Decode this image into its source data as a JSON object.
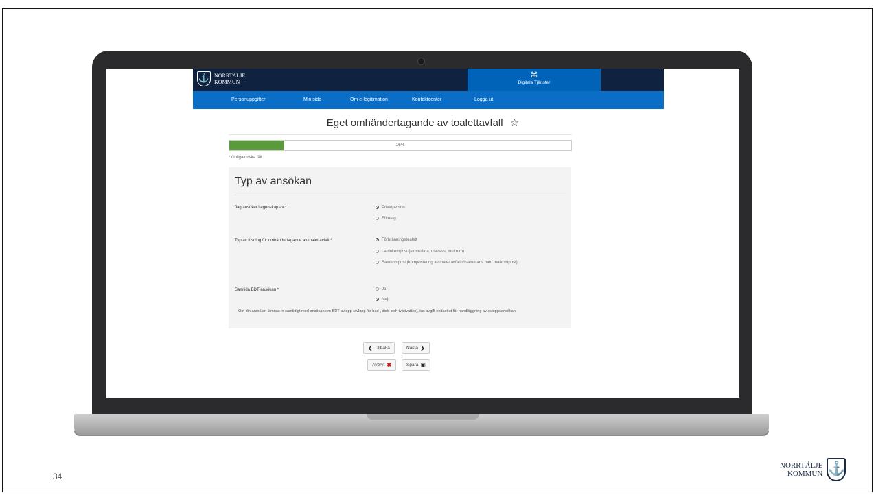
{
  "slide": {
    "page_number": "34"
  },
  "branding": {
    "logo_line1": "NORRTÄLJE",
    "logo_line2": "KOMMUN"
  },
  "header": {
    "digital_services_label": "Digitala Tjänster"
  },
  "nav": {
    "items": [
      "Personuppgifter",
      "Min sida",
      "Om e-legitimation",
      "Kontaktcenter",
      "Logga ut"
    ]
  },
  "page": {
    "title": "Eget omhändertagande av toalettavfall",
    "favorite_icon": "star-outline-icon",
    "progress": {
      "label": "16%",
      "value": 0.16
    },
    "required_note": "* Obligatoriska fält"
  },
  "form": {
    "section_title": "Typ av ansökan",
    "q1": {
      "label": "Jag ansöker i egenskap av *",
      "options": [
        "Privatperson",
        "Företag"
      ],
      "selected": 0
    },
    "q2": {
      "label": "Typ av lösning för omhändertagande av toalettavfall *",
      "options": [
        "Förbränningstoalett",
        "Latrinkompost (ex mulltoa, utedass, multrum)",
        "Samkompost (kompostering av toalettavfall tillsammans med matkompost)"
      ],
      "selected": 0
    },
    "q3": {
      "label": "Samtida BDT-ansökan *",
      "options": [
        "Ja",
        "Nej"
      ],
      "selected": 1
    },
    "info": "Om din anmälan lämnas in samtidigt med ansökan om BDT-avlopp (avlopp för bad-, disk- och tvättvatten), tas avgift endast ut för handläggning av avloppsansökan."
  },
  "buttons": {
    "back": "Tillbaka",
    "next": "Nästa",
    "cancel": "Avbryt",
    "save": "Spara"
  },
  "colors": {
    "header_dark": "#0f2240",
    "nav_blue": "#0a6ec6",
    "accent_blue": "#0063b7",
    "progress_green": "#5b9a3c"
  }
}
